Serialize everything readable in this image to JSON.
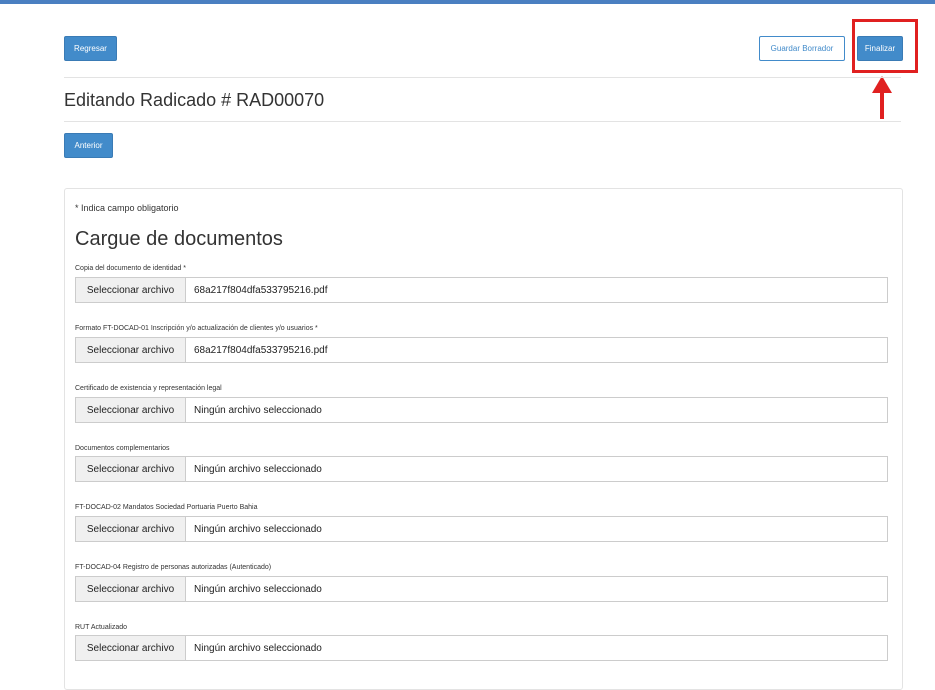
{
  "header": {
    "back_label": "Regresar",
    "save_draft_label": "Guardar Borrador",
    "finish_label": "Finalizar"
  },
  "page": {
    "title": "Editando Radicado # RAD00070",
    "previous_label": "Anterior"
  },
  "form": {
    "required_note": "* Indica campo obligatorio",
    "section_title": "Cargue de documentos",
    "fields": [
      {
        "label": "Copia del documento de identidad *",
        "button": "Seleccionar archivo",
        "file": "68a217f804dfa533795216.pdf"
      },
      {
        "label": "Formato FT-DOCAD-01 Inscripción y/o actualización de clientes y/o usuarios *",
        "button": "Seleccionar archivo",
        "file": "68a217f804dfa533795216.pdf"
      },
      {
        "label": "Certificado de existencia y representación legal",
        "button": "Seleccionar archivo",
        "file": "Ningún archivo seleccionado"
      },
      {
        "label": "Documentos complementarios",
        "button": "Seleccionar archivo",
        "file": "Ningún archivo seleccionado"
      },
      {
        "label": "FT-DOCAD-02 Mandatos Sociedad Portuaria Puerto Bahia",
        "button": "Seleccionar archivo",
        "file": "Ningún archivo seleccionado"
      },
      {
        "label": "FT-DOCAD-04 Registro de personas autorizadas (Autenticado)",
        "button": "Seleccionar archivo",
        "file": "Ningún archivo seleccionado"
      },
      {
        "label": "RUT Actualizado",
        "button": "Seleccionar archivo",
        "file": "Ningún archivo seleccionado"
      }
    ]
  },
  "annotation": {
    "highlight_color": "#e02020"
  }
}
